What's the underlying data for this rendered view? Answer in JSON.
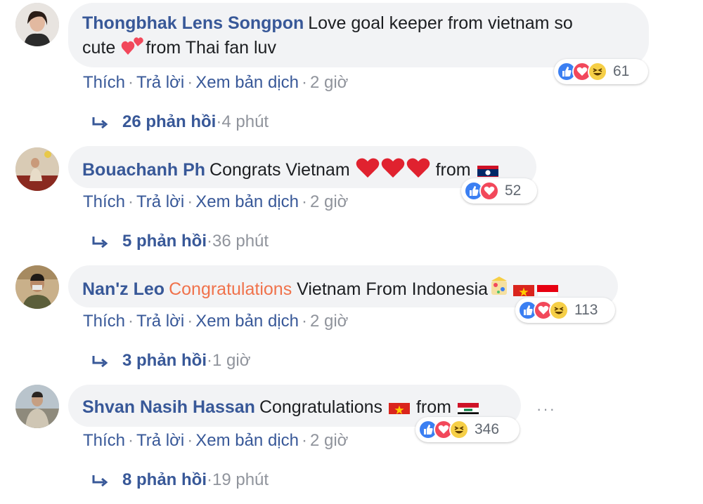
{
  "comments": [
    {
      "author": "Thongbhak Lens Songpon",
      "text_1": "Love goal keeper from vietnam so",
      "text_2": "cute",
      "text_3": "from Thai fan luv",
      "reaction_count": "61",
      "actions": {
        "like": "Thích",
        "reply": "Trả lời",
        "translate": "Xem bản dịch",
        "time": "2 giờ"
      },
      "replies": {
        "label": "26 phản hồi",
        "time": "4 phút"
      }
    },
    {
      "author": "Bouachanh Ph",
      "text_1": "Congrats Vietnam",
      "text_2": "from",
      "reaction_count": "52",
      "actions": {
        "like": "Thích",
        "reply": "Trả lời",
        "translate": "Xem bản dịch",
        "time": "2 giờ"
      },
      "replies": {
        "label": "5 phản hồi",
        "time": "36 phút"
      }
    },
    {
      "author": "Nan'z Leo",
      "highlight": "Congratulations",
      "text_1": "Vietnam From Indonesia",
      "reaction_count": "113",
      "actions": {
        "like": "Thích",
        "reply": "Trả lời",
        "translate": "Xem bản dịch",
        "time": "2 giờ"
      },
      "replies": {
        "label": "3 phản hồi",
        "time": "1 giờ"
      }
    },
    {
      "author": "Shvan Nasih Hassan",
      "text_1": "Congratulations",
      "text_2": "from",
      "reaction_count": "346",
      "actions": {
        "like": "Thích",
        "reply": "Trả lời",
        "translate": "Xem bản dịch",
        "time": "2 giờ"
      },
      "replies": {
        "label": "8 phản hồi",
        "time": "19 phút"
      }
    }
  ],
  "more_options": "···",
  "separator": "·",
  "colors": {
    "link": "#385898",
    "meta": "#90949c",
    "bubble": "#f2f3f5",
    "highlight": "#f0724b",
    "like": "#3b7ff2",
    "love": "#f2485b",
    "haha": "#f6cf47"
  }
}
